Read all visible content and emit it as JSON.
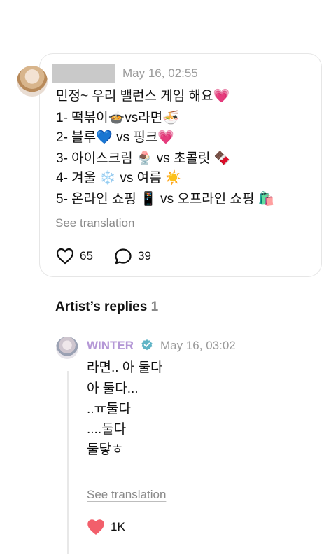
{
  "fan_post": {
    "timestamp": "May 16, 02:55",
    "lines": [
      "민정~ 우리 밸런스 게임 해요💗",
      "1- 떡볶이🍲vs라면🍜",
      "2- 블루💙 vs 핑크💗",
      "3- 아이스크림 🍨 vs 초콜릿 🍫",
      "4- 겨울 ❄️       vs 여름 ☀️",
      "5- 온라인 쇼핑 📱 vs 오프라인 쇼핑 🛍️"
    ],
    "see_translation": "See translation",
    "likes": "65",
    "replies": "39"
  },
  "artist_replies": {
    "title": "Artist’s replies",
    "count": "1"
  },
  "artist_reply": {
    "name": "WINTER",
    "timestamp": "May 16, 03:02",
    "lines": [
      "라면.. 아 둘다",
      "아 둘다...",
      "..ㅠ둘다",
      "....둘다",
      "둘닿ㅎ"
    ],
    "see_translation": "See translation",
    "likes": "1K"
  },
  "colors": {
    "artist_name": "#b497d6",
    "verified_badge": "#5fb4c6",
    "heart_filled": "#f25f6b"
  },
  "icons": {
    "like": "heart-outline-icon",
    "reply": "speech-bubble-icon",
    "liked": "heart-filled-icon",
    "verified": "verified-badge-icon"
  }
}
